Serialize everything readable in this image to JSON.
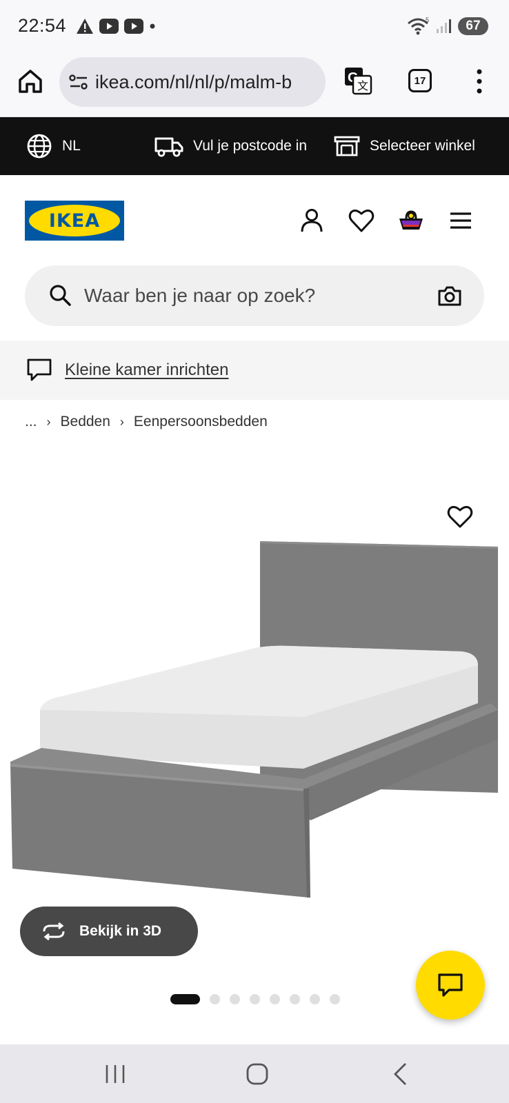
{
  "status_bar": {
    "time": "22:54",
    "signal_sub": "5",
    "battery": "67"
  },
  "browser": {
    "url": "ikea.com/nl/nl/p/malm-b",
    "tab_count": "17"
  },
  "utility_bar": {
    "language": "NL",
    "postcode_label": "Vul je postcode in",
    "store_label": "Selecteer winkel"
  },
  "header": {
    "logo_text": "IKEA"
  },
  "search": {
    "placeholder": "Waar ben je naar op zoek?"
  },
  "promo": {
    "link_text": "Kleine kamer inrichten"
  },
  "breadcrumb": {
    "items": [
      "...",
      "Bedden",
      "Eenpersoonsbedden"
    ]
  },
  "product": {
    "view_3d_label": "Bekijk in 3D",
    "carousel_total": 8,
    "carousel_active": 1
  },
  "colors": {
    "ikea_blue": "#0058a3",
    "ikea_yellow": "#ffdb00",
    "utility_bg": "#111111",
    "bed_grey": "#7c7c7c"
  }
}
